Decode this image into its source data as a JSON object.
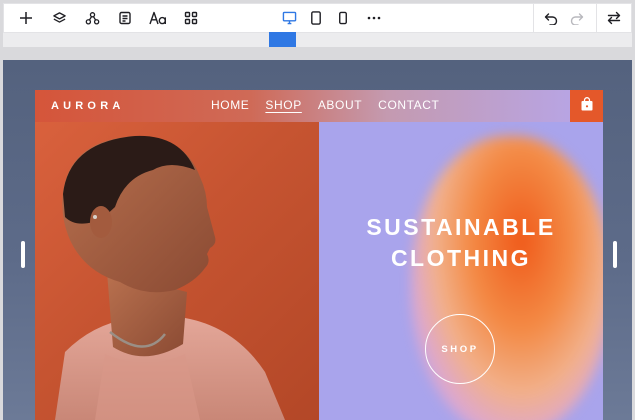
{
  "toolbar": {
    "left_tools": [
      {
        "name": "add-icon"
      },
      {
        "name": "layers-icon"
      },
      {
        "name": "components-icon"
      },
      {
        "name": "pages-icon"
      },
      {
        "name": "typography-icon"
      },
      {
        "name": "apps-grid-icon"
      }
    ],
    "device_views": [
      {
        "name": "desktop-view-icon",
        "active": true
      },
      {
        "name": "tablet-view-icon",
        "active": false
      },
      {
        "name": "mobile-view-icon",
        "active": false
      }
    ],
    "more_icon": "more-horizontal-icon",
    "right_tools": [
      {
        "name": "undo-icon",
        "enabled": true
      },
      {
        "name": "redo-icon",
        "enabled": false
      },
      {
        "name": "swap-icon",
        "enabled": true
      }
    ],
    "accent_color": "#2f78e4"
  },
  "site": {
    "logo": "AURORA",
    "nav": [
      {
        "label": "HOME",
        "active": false
      },
      {
        "label": "SHOP",
        "active": true
      },
      {
        "label": "ABOUT",
        "active": false
      },
      {
        "label": "CONTACT",
        "active": false
      }
    ],
    "cart_icon": "shopping-bag-icon",
    "hero": {
      "title_line1": "SUSTAINABLE",
      "title_line2": "CLOTHING",
      "button_label": "SHOP"
    },
    "colors": {
      "header_start": "#d5553a",
      "header_end": "#b6a6ec",
      "cart_bg": "#e4582a",
      "photo_bg": "#c65431",
      "hero_bg": "#a9a4ec",
      "blob": "#f05a1a"
    }
  }
}
